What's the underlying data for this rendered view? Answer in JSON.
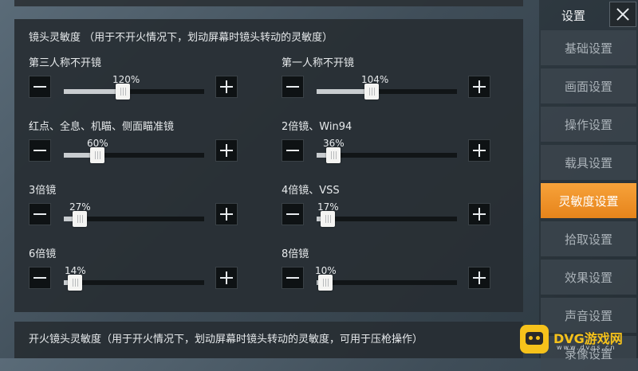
{
  "main": {
    "section_title": "镜头灵敏度 （用于不开火情况下，划动屏幕时镜头转动的灵敏度）",
    "sliders": [
      {
        "label": "第三人称不开镜",
        "value_text": "120%",
        "fraction": 0.37
      },
      {
        "label": "第一人称不开镜",
        "value_text": "104%",
        "fraction": 0.34
      },
      {
        "label": "红点、全息、机瞄、侧面瞄准镜",
        "value_text": "60%",
        "fraction": 0.19
      },
      {
        "label": "2倍镜、Win94",
        "value_text": "36%",
        "fraction": 0.07
      },
      {
        "label": "3倍镜",
        "value_text": "27%",
        "fraction": 0.06
      },
      {
        "label": "4倍镜、VSS",
        "value_text": "17%",
        "fraction": 0.03
      },
      {
        "label": "6倍镜",
        "value_text": "14%",
        "fraction": 0.03
      },
      {
        "label": "8倍镜",
        "value_text": "10%",
        "fraction": 0.01
      }
    ],
    "section_title_2": "开火镜头灵敏度（用于开火情况下，划动屏幕时镜头转动的灵敏度，可用于压枪操作）"
  },
  "sidebar": {
    "title": "设置",
    "items": [
      {
        "label": "基础设置"
      },
      {
        "label": "画面设置"
      },
      {
        "label": "操作设置"
      },
      {
        "label": "载具设置"
      },
      {
        "label": "灵敏度设置",
        "active": true
      },
      {
        "label": "拾取设置"
      },
      {
        "label": "效果设置"
      },
      {
        "label": "声音设置"
      },
      {
        "label": "录像设置"
      }
    ]
  },
  "watermark": {
    "text": "DVG游戏网",
    "sub": "www.dvgs.cn"
  },
  "colors": {
    "accent": "#f0932b",
    "panel": "#2a3036",
    "track": "#111517",
    "fill": "#c9cdd0"
  }
}
